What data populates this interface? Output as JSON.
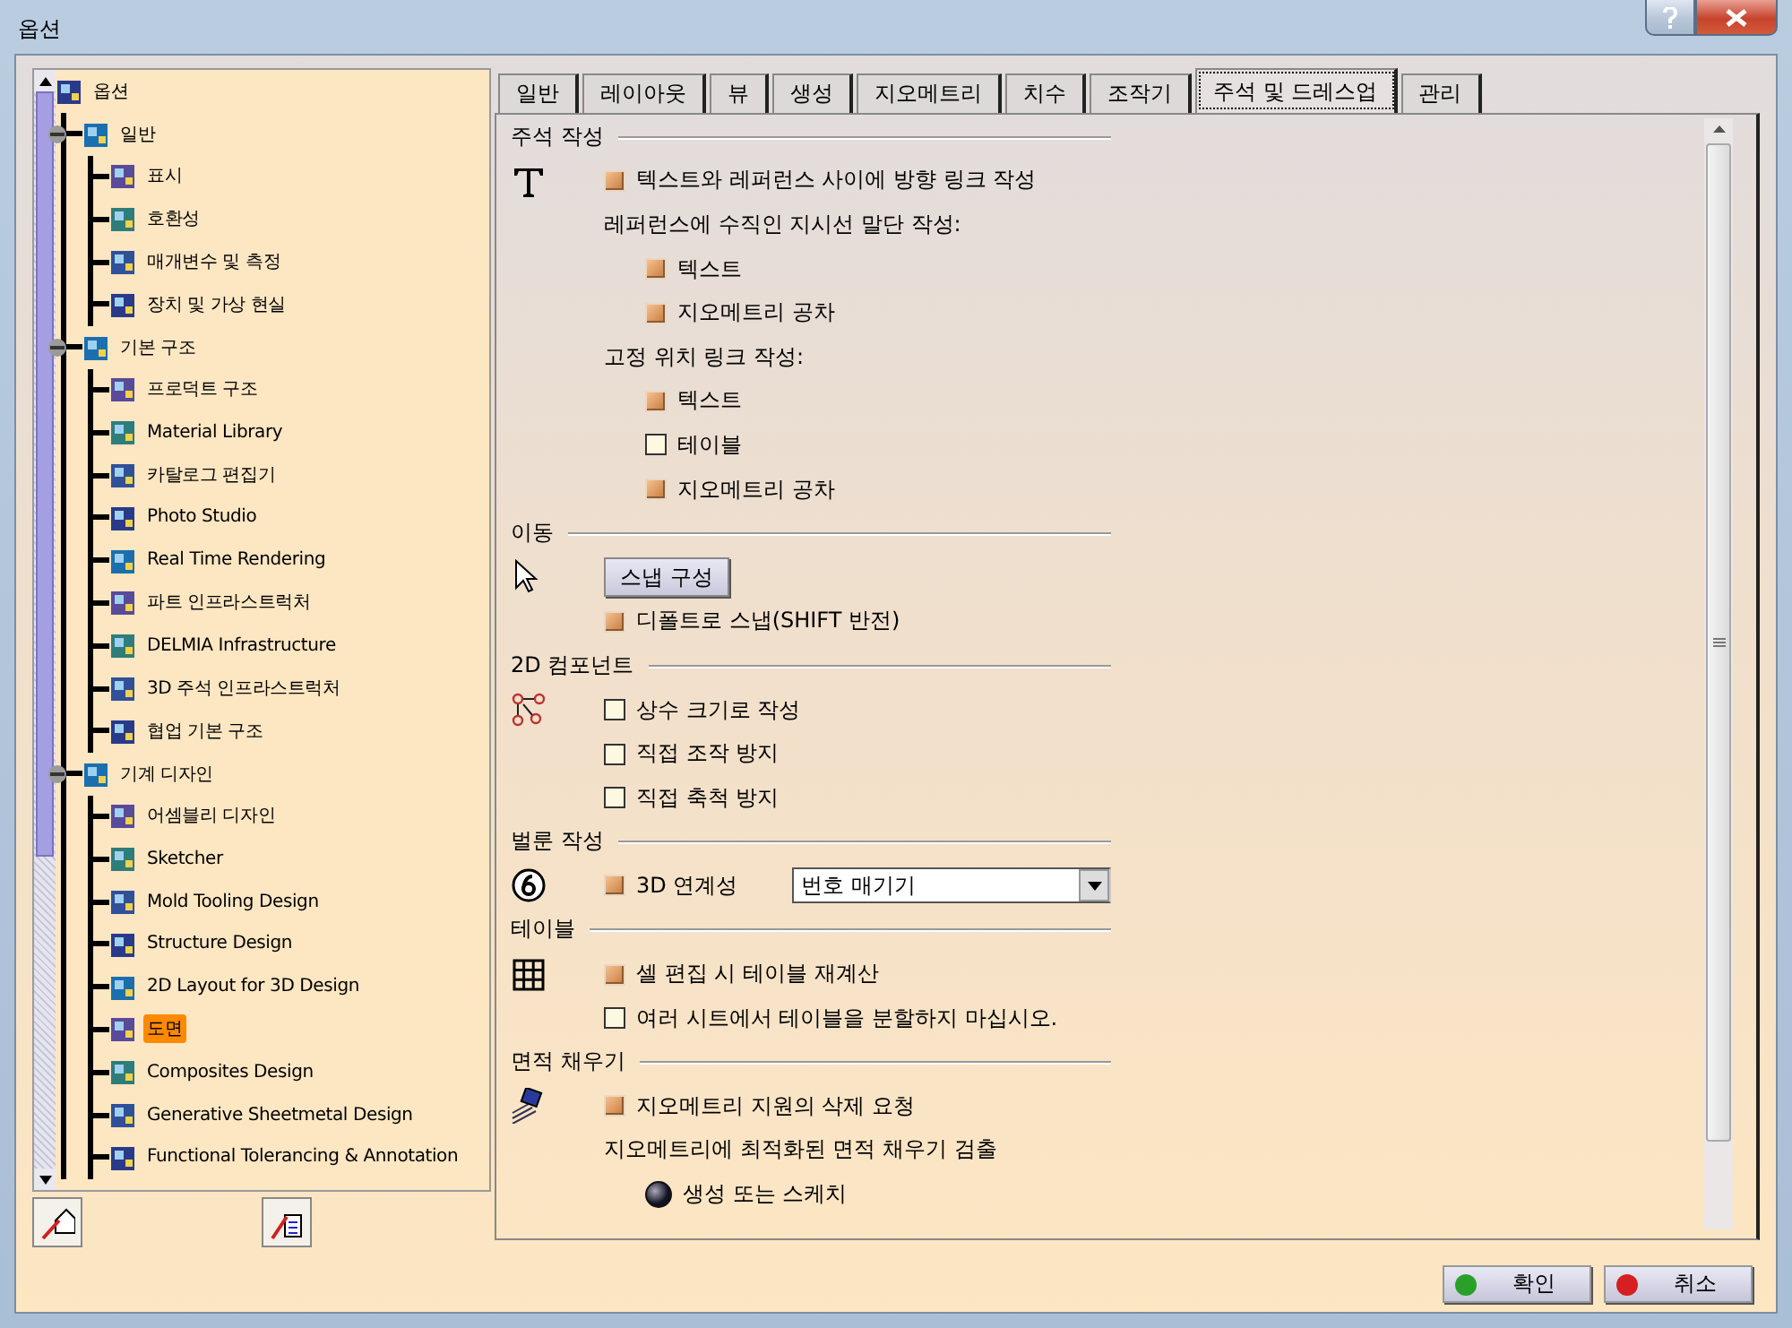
{
  "window": {
    "title": "옵션"
  },
  "tree": {
    "label": "옵션",
    "selected": false,
    "children": [
      {
        "label": "일반",
        "selected": false,
        "expanded": true,
        "children": [
          {
            "label": "표시",
            "selected": false
          },
          {
            "label": "호환성",
            "selected": false
          },
          {
            "label": "매개변수 및 측정",
            "selected": false
          },
          {
            "label": "장치 및 가상 현실",
            "selected": false
          }
        ]
      },
      {
        "label": "기본 구조",
        "selected": false,
        "expanded": true,
        "children": [
          {
            "label": "프로덕트 구조",
            "selected": false
          },
          {
            "label": "Material Library",
            "selected": false
          },
          {
            "label": "카탈로그 편집기",
            "selected": false
          },
          {
            "label": "Photo Studio",
            "selected": false
          },
          {
            "label": "Real Time Rendering",
            "selected": false
          },
          {
            "label": "파트 인프라스트럭처",
            "selected": false
          },
          {
            "label": "DELMIA Infrastructure",
            "selected": false
          },
          {
            "label": "3D 주석 인프라스트럭처",
            "selected": false
          },
          {
            "label": "협업 기본 구조",
            "selected": false
          }
        ]
      },
      {
        "label": "기계 디자인",
        "selected": false,
        "expanded": true,
        "children": [
          {
            "label": "어셈블리 디자인",
            "selected": false
          },
          {
            "label": "Sketcher",
            "selected": false
          },
          {
            "label": "Mold Tooling Design",
            "selected": false
          },
          {
            "label": "Structure Design",
            "selected": false
          },
          {
            "label": "2D Layout for 3D Design",
            "selected": false
          },
          {
            "label": "도면",
            "selected": true
          },
          {
            "label": "Composites Design",
            "selected": false
          },
          {
            "label": "Generative Sheetmetal Design",
            "selected": false
          },
          {
            "label": "Functional Tolerancing & Annotation",
            "selected": false
          }
        ]
      }
    ]
  },
  "tabs": [
    {
      "label": "일반",
      "selected": false
    },
    {
      "label": "레이아웃",
      "selected": false
    },
    {
      "label": "뷰",
      "selected": false
    },
    {
      "label": "생성",
      "selected": false
    },
    {
      "label": "지오메트리",
      "selected": false
    },
    {
      "label": "치수",
      "selected": false
    },
    {
      "label": "조작기",
      "selected": false
    },
    {
      "label": "주석 및 드레스업",
      "selected": true
    },
    {
      "label": "관리",
      "selected": false
    }
  ],
  "sections": [
    {
      "title": "주석 작성",
      "rows": [
        {
          "kind": "checkbox",
          "label": "텍스트와 레퍼런스 사이에 방향 링크 작성",
          "checked": true
        },
        {
          "kind": "text",
          "label": "레퍼런스에 수직인 지시선 말단 작성:",
          "children": [
            {
              "kind": "checkbox",
              "label": "텍스트",
              "checked": true
            },
            {
              "kind": "checkbox",
              "label": "지오메트리 공차",
              "checked": true
            }
          ]
        },
        {
          "kind": "text",
          "label": "고정 위치 링크 작성:",
          "children": [
            {
              "kind": "checkbox",
              "label": "텍스트",
              "checked": true
            },
            {
              "kind": "checkbox",
              "label": "테이블",
              "checked": false
            },
            {
              "kind": "checkbox",
              "label": "지오메트리 공차",
              "checked": true
            }
          ]
        }
      ]
    },
    {
      "title": "이동",
      "rows": [
        {
          "kind": "button",
          "label": "스냅 구성"
        },
        {
          "kind": "checkbox",
          "label": "디폴트로 스냅(SHIFT 반전)",
          "checked": true
        }
      ]
    },
    {
      "title": "2D 컴포넌트",
      "rows": [
        {
          "kind": "checkbox",
          "label": "상수 크기로 작성",
          "checked": false
        },
        {
          "kind": "checkbox",
          "label": "직접 조작 방지",
          "checked": false
        },
        {
          "kind": "checkbox",
          "label": "직접 축척 방지",
          "checked": false
        }
      ]
    },
    {
      "title": "벌룬 작성",
      "rows": [
        {
          "kind": "checkbox_dropdown",
          "label": "3D 연계성",
          "checked": true,
          "value": "번호 매기기"
        }
      ]
    },
    {
      "title": "테이블",
      "rows": [
        {
          "kind": "checkbox",
          "label": "셀 편집 시 테이블 재계산",
          "checked": true
        },
        {
          "kind": "checkbox",
          "label": "여러 시트에서 테이블을 분할하지 마십시오.",
          "checked": false
        }
      ]
    },
    {
      "title": "면적 채우기",
      "rows": [
        {
          "kind": "checkbox",
          "label": "지오메트리 지원의 삭제 요청",
          "checked": true
        },
        {
          "kind": "text",
          "label": "지오메트리에 최적화된 면적 채우기 검출",
          "children": [
            {
              "kind": "radio",
              "label": "생성 또는 스케치",
              "selected": true
            }
          ]
        }
      ]
    }
  ],
  "dialog_buttons": [
    {
      "label": "확인",
      "kind": "ok"
    },
    {
      "label": "취소",
      "kind": "cancel"
    }
  ]
}
